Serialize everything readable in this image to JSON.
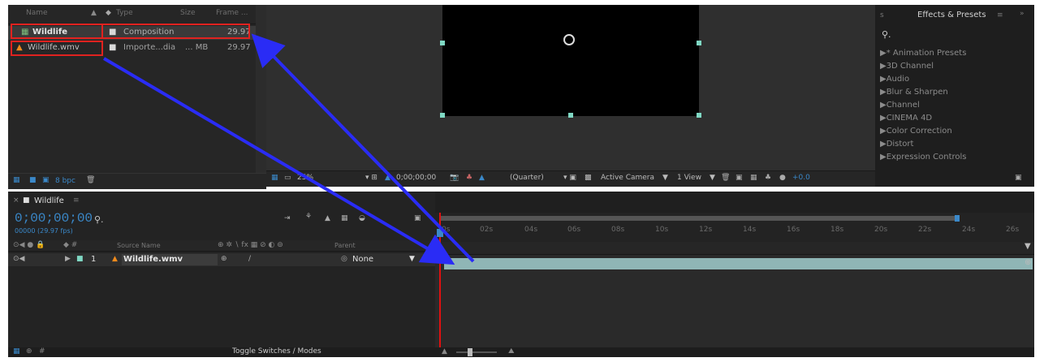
{
  "project": {
    "headers": {
      "name": "Name",
      "type": "Type",
      "size": "Size",
      "frame": "Frame ..."
    },
    "rows": [
      {
        "name": "Wildlife",
        "type": "Composition",
        "size": "",
        "frame": "29.97"
      },
      {
        "name": "Wildlife.wmv",
        "type": "Importe...dia",
        "size": "... MB",
        "frame": "29.97"
      }
    ],
    "bpc": "8 bpc"
  },
  "viewer": {
    "zoom": "25%",
    "timecode": "0;00;00;00",
    "resolution": "(Quarter)",
    "camera": "Active Camera",
    "views": "1 View",
    "exposure": "+0.0"
  },
  "effects": {
    "title": "Effects & Presets",
    "search_icon": "search-icon",
    "items": [
      "▶* Animation Presets",
      "▶3D Channel",
      "▶Audio",
      "▶Blur & Sharpen",
      "▶Channel",
      "▶CINEMA 4D",
      "▶Color Correction",
      "▶Distort",
      "▶Expression Controls"
    ]
  },
  "timeline": {
    "tab": "Wildlife",
    "timecode": "0;00;00;00",
    "fps": "00000 (29.97 fps)",
    "col_source": "Source Name",
    "col_parent": "Parent",
    "layer_num": "1",
    "layer_name": "Wildlife.wmv",
    "parent_value": "None",
    "ruler": [
      "0s",
      "02s",
      "04s",
      "06s",
      "08s",
      "10s",
      "12s",
      "14s",
      "16s",
      "18s",
      "20s",
      "22s",
      "24s",
      "26s"
    ],
    "toggle": "Toggle Switches / Modes"
  },
  "colors": {
    "accent_red": "#e0221f",
    "arrow_blue": "#2a2cf5",
    "layer_bar": "#8fb6b6",
    "playhead": "#e01010"
  }
}
